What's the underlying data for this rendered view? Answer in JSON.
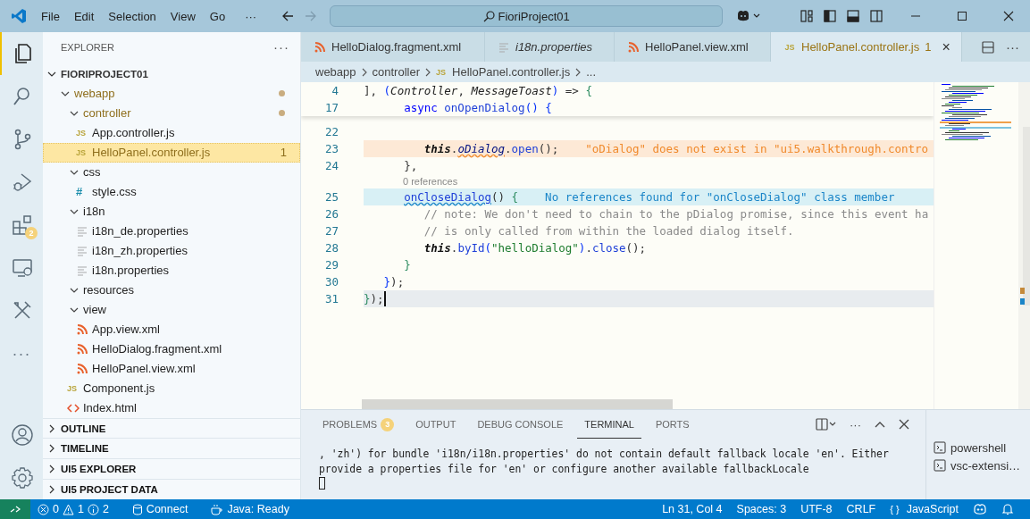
{
  "title_bar": {
    "menu": [
      {
        "label": "File"
      },
      {
        "label": "Edit"
      },
      {
        "label": "Selection"
      },
      {
        "label": "View"
      },
      {
        "label": "Go"
      }
    ],
    "more": "···",
    "search": {
      "value": "FioriProject01"
    }
  },
  "activity_bar": {
    "items": [
      {
        "kind": "files",
        "selected": true
      },
      {
        "kind": "search",
        "selected": false
      },
      {
        "kind": "source-control",
        "selected": false
      },
      {
        "kind": "debug",
        "selected": false
      },
      {
        "kind": "extensions",
        "selected": false,
        "badge": "2"
      },
      {
        "kind": "remote",
        "selected": false
      },
      {
        "kind": "tools",
        "selected": false
      }
    ],
    "more": "···"
  },
  "sidebar": {
    "title": "EXPLORER",
    "more": "···",
    "root": {
      "label": "FIORIPROJECT01",
      "expanded": true
    },
    "tree": [
      {
        "label": "webapp",
        "kind": "folder",
        "expanded": true,
        "modified": true,
        "selected": false,
        "children": [
          {
            "label": "controller",
            "kind": "folder",
            "expanded": true,
            "modified": true,
            "selected": false,
            "children": [
              {
                "label": "App.controller.js",
                "kind": "js",
                "icon": "JS",
                "modified": false,
                "selected": false
              },
              {
                "label": "HelloPanel.controller.js",
                "kind": "js",
                "icon": "JS",
                "modified": true,
                "selected": true,
                "problems": "1"
              }
            ]
          },
          {
            "label": "css",
            "kind": "folder",
            "expanded": true,
            "modified": false,
            "selected": false,
            "children": [
              {
                "label": "style.css",
                "kind": "css",
                "icon": "#",
                "modified": false,
                "selected": false
              }
            ]
          },
          {
            "label": "i18n",
            "kind": "folder",
            "expanded": true,
            "modified": false,
            "selected": false,
            "children": [
              {
                "label": "i18n_de.properties",
                "kind": "text",
                "modified": false,
                "selected": false
              },
              {
                "label": "i18n_zh.properties",
                "kind": "text",
                "modified": false,
                "selected": false
              },
              {
                "label": "i18n.properties",
                "kind": "text",
                "modified": false,
                "selected": false
              }
            ]
          },
          {
            "label": "resources",
            "kind": "folder",
            "expanded": true,
            "modified": false,
            "selected": false
          },
          {
            "label": "view",
            "kind": "folder",
            "expanded": true,
            "modified": false,
            "selected": false,
            "children": [
              {
                "label": "App.view.xml",
                "kind": "xml",
                "modified": false,
                "selected": false
              },
              {
                "label": "HelloDialog.fragment.xml",
                "kind": "xml",
                "modified": false,
                "selected": false
              },
              {
                "label": "HelloPanel.view.xml",
                "kind": "xml",
                "modified": false,
                "selected": false
              }
            ]
          },
          {
            "label": "Component.js",
            "kind": "js",
            "icon": "JS",
            "modified": false,
            "selected": false
          },
          {
            "label": "Index.html",
            "kind": "html",
            "modified": false,
            "selected": false
          }
        ]
      }
    ],
    "sections": [
      {
        "label": "OUTLINE",
        "expanded": false
      },
      {
        "label": "TIMELINE",
        "expanded": false
      },
      {
        "label": "UI5 EXPLORER",
        "expanded": false
      },
      {
        "label": "UI5 PROJECT DATA",
        "expanded": false
      }
    ]
  },
  "editor": {
    "tabs": [
      {
        "label": "HelloDialog.fragment.xml",
        "kind": "xml",
        "selected": false,
        "preview": false
      },
      {
        "label": "i18n.properties",
        "kind": "text",
        "selected": false,
        "preview": true
      },
      {
        "label": "HelloPanel.view.xml",
        "kind": "xml",
        "selected": false,
        "preview": false
      },
      {
        "label": "HelloPanel.controller.js",
        "kind": "js",
        "icon": "JS",
        "selected": true,
        "preview": false,
        "problems": "1",
        "close": "×"
      }
    ],
    "more": "···",
    "breadcrumb": [
      {
        "label": "webapp"
      },
      {
        "label": "controller"
      },
      {
        "label": "HelloPanel.controller.js",
        "kind": "js",
        "icon": "JS"
      },
      {
        "label": "..."
      }
    ],
    "sticky_lines": [
      {
        "number": "4",
        "tokens": [
          {
            "text": "], ",
            "kind": "plain"
          },
          {
            "text": "(",
            "kind": "bracket"
          },
          {
            "text": "Controller",
            "kind": "param"
          },
          {
            "text": ", ",
            "kind": "plain"
          },
          {
            "text": "MessageToast",
            "kind": "param"
          },
          {
            "text": ")",
            "kind": "bracket"
          },
          {
            "text": " => ",
            "kind": "plain"
          },
          {
            "text": "{",
            "kind": "bracket2"
          }
        ]
      },
      {
        "number": "17",
        "tokens": [
          {
            "text": "      async ",
            "kind": "kw"
          },
          {
            "text": "onOpenDialog",
            "kind": "fn"
          },
          {
            "text": "() ",
            "kind": "bracket"
          },
          {
            "text": "{",
            "kind": "bracket"
          }
        ]
      }
    ],
    "lines": [
      {
        "number": "22",
        "kind": "plain"
      },
      {
        "number": "23",
        "kind": "warning",
        "tokens": [
          {
            "text": "         this",
            "kind": "this"
          },
          {
            "text": ".",
            "kind": "plain"
          },
          {
            "text": "oDialog",
            "kind": "warning-squiggle"
          },
          {
            "text": ".",
            "kind": "plain"
          },
          {
            "text": "open",
            "kind": "fn"
          },
          {
            "text": "();",
            "kind": "plain"
          },
          {
            "text": "\"oDialog\" does not exist in \"ui5.walkthrough.contro",
            "kind": "hint-warning"
          }
        ]
      },
      {
        "number": "24",
        "kind": "plain",
        "tokens": [
          {
            "text": "      },",
            "kind": "plain"
          }
        ]
      },
      {
        "codelens": "0 references"
      },
      {
        "number": "25",
        "kind": "info",
        "tokens": [
          {
            "text": "      onCloseDialog",
            "kind": "info-squiggle"
          },
          {
            "text": "() ",
            "kind": "plain"
          },
          {
            "text": "{",
            "kind": "bracket2"
          },
          {
            "text": "No references found for \"onCloseDialog\" class member",
            "kind": "hint-info"
          }
        ]
      },
      {
        "number": "26",
        "kind": "plain",
        "tokens": [
          {
            "text": "         // note: We don't need to chain to the pDialog promise, since this event ha",
            "kind": "comment"
          }
        ]
      },
      {
        "number": "27",
        "kind": "plain",
        "tokens": [
          {
            "text": "         // is only called from within the loaded dialog itself.",
            "kind": "comment"
          }
        ]
      },
      {
        "number": "28",
        "kind": "plain",
        "tokens": [
          {
            "text": "         this",
            "kind": "this"
          },
          {
            "text": ".",
            "kind": "plain"
          },
          {
            "text": "byId",
            "kind": "fn"
          },
          {
            "text": "(",
            "kind": "bracket"
          },
          {
            "text": "\"helloDialog\"",
            "kind": "str"
          },
          {
            "text": ")",
            "kind": "bracket"
          },
          {
            "text": ".",
            "kind": "plain"
          },
          {
            "text": "close",
            "kind": "fn"
          },
          {
            "text": "();",
            "kind": "plain"
          }
        ]
      },
      {
        "number": "29",
        "kind": "plain",
        "tokens": [
          {
            "text": "      }",
            "kind": "bracket2"
          }
        ]
      },
      {
        "number": "30",
        "kind": "plain",
        "tokens": [
          {
            "text": "   }",
            "kind": "bracket"
          },
          {
            "text": ");",
            "kind": "plain"
          }
        ]
      },
      {
        "number": "31",
        "kind": "current",
        "tokens": [
          {
            "text": "}",
            "kind": "bracket2"
          },
          {
            "text": ");",
            "kind": "plain"
          }
        ]
      }
    ]
  },
  "panel": {
    "tabs": [
      {
        "label": "PROBLEMS",
        "selected": false,
        "badge": "3"
      },
      {
        "label": "OUTPUT",
        "selected": false
      },
      {
        "label": "DEBUG CONSOLE",
        "selected": false
      },
      {
        "label": "TERMINAL",
        "selected": true
      },
      {
        "label": "PORTS",
        "selected": false
      }
    ],
    "more": "···",
    "terminal_lines": [
      ", 'zh') for bundle 'i18n/i18n.properties' do not contain default fallback locale 'en'. Either",
      "provide a properties file for 'en' or configure another available fallbackLocale"
    ],
    "terminals": [
      {
        "label": "powershell"
      },
      {
        "label": "vsc-extensi…"
      }
    ]
  },
  "status_bar": {
    "errors": "0",
    "warnings": "1",
    "infos": "2",
    "left": [
      {
        "kind": "database",
        "label": "Connect"
      },
      {
        "kind": "cup",
        "label": "Java: Ready"
      }
    ],
    "right": [
      {
        "kind": "text",
        "label": "Ln 31, Col 4"
      },
      {
        "kind": "text",
        "label": "Spaces: 3"
      },
      {
        "kind": "text",
        "label": "UTF-8"
      },
      {
        "kind": "text",
        "label": "CRLF"
      },
      {
        "kind": "braces",
        "icon": "{ }",
        "label": "JavaScript"
      },
      {
        "kind": "copilot"
      },
      {
        "kind": "bell"
      }
    ]
  }
}
